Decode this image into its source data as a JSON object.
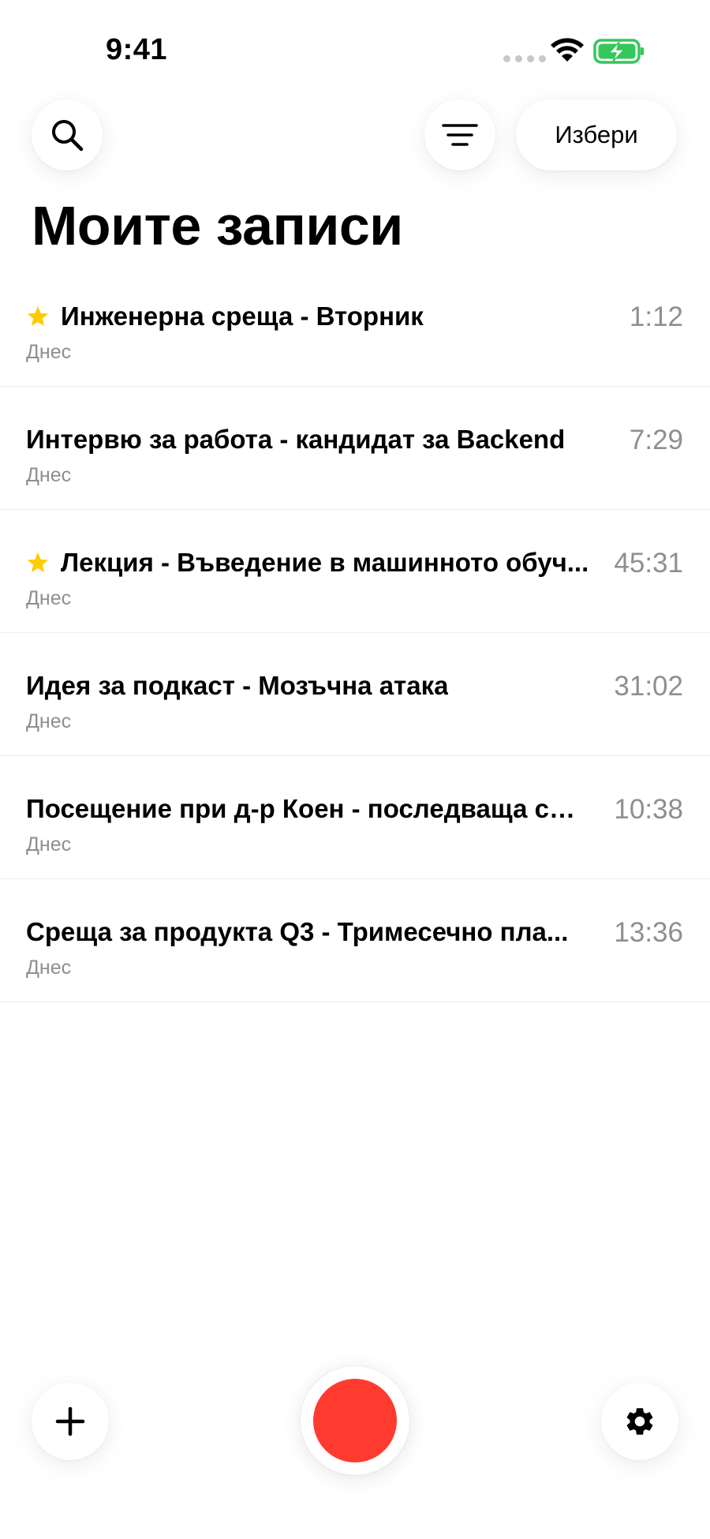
{
  "status_bar": {
    "time": "9:41",
    "icons": [
      "signal-dots-icon",
      "wifi-icon",
      "battery-charging-icon"
    ],
    "battery_color": "#34c759"
  },
  "toolbar": {
    "search_icon": "search-icon",
    "filter_icon": "filter-lines-icon",
    "select_label": "Избери"
  },
  "page": {
    "title": "Моите записи"
  },
  "colors": {
    "accent_star": "#ffcc00",
    "record": "#ff3b30",
    "secondary_text": "#8e8e93"
  },
  "recordings": [
    {
      "title": "Инженерна среща - Вторник",
      "date": "Днес",
      "duration": "1:12",
      "starred": true
    },
    {
      "title": "Интервю за работа - кандидат за Backend",
      "date": "Днес",
      "duration": "7:29",
      "starred": false
    },
    {
      "title": "Лекция - Въведение в машинното обуч...",
      "date": "Днес",
      "duration": "45:31",
      "starred": true
    },
    {
      "title": "Идея за подкаст - Мозъчна атака",
      "date": "Днес",
      "duration": "31:02",
      "starred": false
    },
    {
      "title": "Посещение при д-р Коен - последваща ср...",
      "date": "Днес",
      "duration": "10:38",
      "starred": false
    },
    {
      "title": "Среща за продукта Q3 - Тримесечно пла...",
      "date": "Днес",
      "duration": "13:36",
      "starred": false
    }
  ],
  "bottom_bar": {
    "add_icon": "plus-icon",
    "record_icon": "record-icon",
    "settings_icon": "gear-icon"
  }
}
